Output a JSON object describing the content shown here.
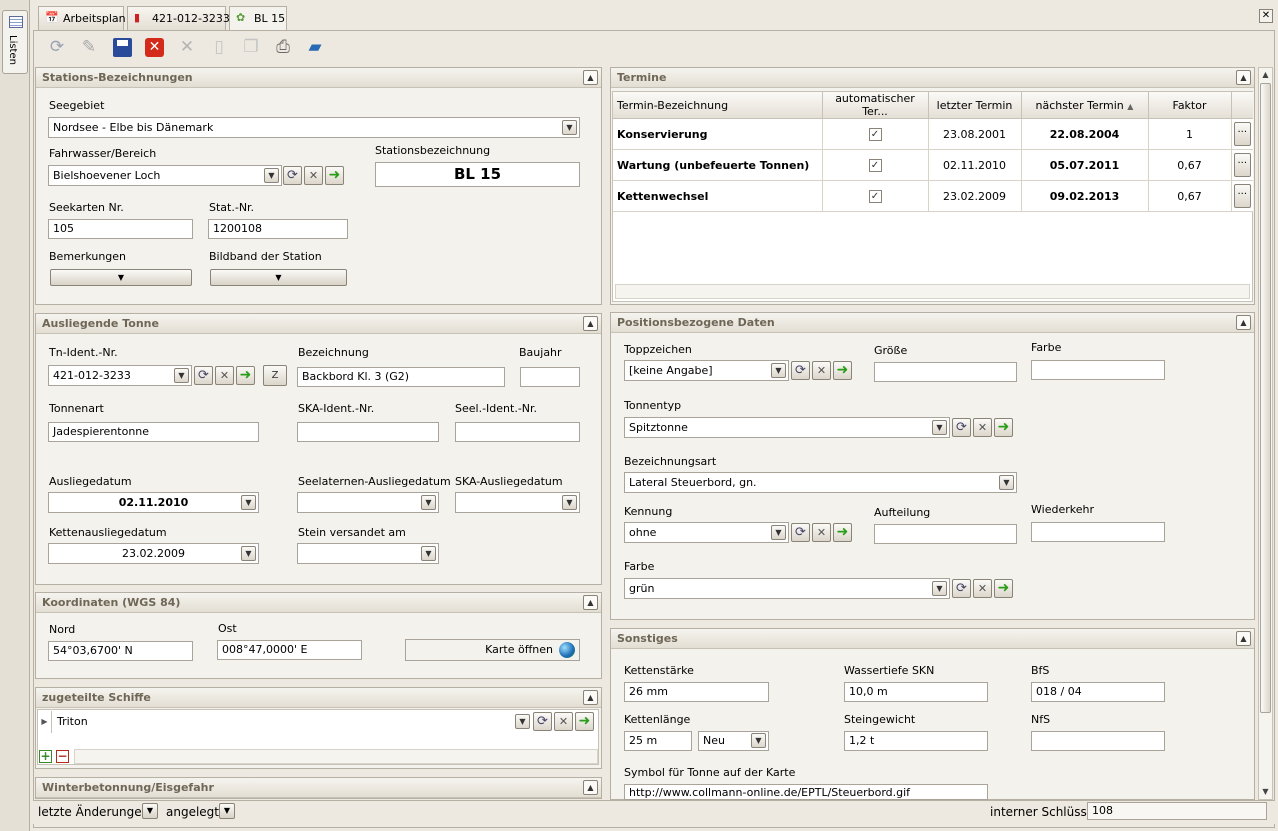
{
  "tabs": [
    {
      "label": "Arbeitsplan"
    },
    {
      "label": "421-012-3233"
    },
    {
      "label": "BL 15"
    }
  ],
  "side_tab": {
    "label": "Listen"
  },
  "stations": {
    "title": "Stations-Bezeichnungen",
    "seegebiet_label": "Seegebiet",
    "seegebiet_value": "Nordsee - Elbe bis Dänemark",
    "fahrwasser_label": "Fahrwasser/Bereich",
    "fahrwasser_value": "Bielshoevener Loch",
    "stationsbez_label": "Stationsbezeichnung",
    "stationsbez_value": "BL 15",
    "seekarten_label": "Seekarten Nr.",
    "seekarten_value": "105",
    "statnr_label": "Stat.-Nr.",
    "statnr_value": "1200108",
    "bemerkungen_label": "Bemerkungen",
    "bildband_label": "Bildband der Station"
  },
  "tonne": {
    "title": "Ausliegende Tonne",
    "tnident_label": "Tn-Ident.-Nr.",
    "tnident_value": "421-012-3233",
    "z_label": "Z",
    "bez_label": "Bezeichnung",
    "bez_value": "Backbord Kl. 3 (G2)",
    "baujahr_label": "Baujahr",
    "baujahr_value": "",
    "tonnenart_label": "Tonnenart",
    "tonnenart_value": "Jadespierentonne",
    "skaident_label": "SKA-Ident.-Nr.",
    "seelident_label": "Seel.-Ident.-Nr.",
    "ausliegedatum_label": "Ausliegedatum",
    "ausliegedatum_value": "02.11.2010",
    "seelaternen_label": "Seelaternen-Ausliegedatum",
    "skaausl_label": "SKA-Ausliegedatum",
    "ketten_label": "Kettenausliegedatum",
    "ketten_value": "23.02.2009",
    "stein_label": "Stein versandet am"
  },
  "koord": {
    "title": "Koordinaten (WGS 84)",
    "nord_label": "Nord",
    "nord_value": "54°03,6700' N",
    "ost_label": "Ost",
    "ost_value": "008°47,0000' E",
    "karte_label": "Karte öffnen"
  },
  "schiffe": {
    "title": "zugeteilte Schiffe",
    "value": "Triton"
  },
  "winter": {
    "title": "Winterbetonnung/Eisgefahr"
  },
  "status": {
    "letzte_label": "letzte Änderungen",
    "angelegt_label": "angelegt",
    "schluessel_label": "interner Schlüssel",
    "schluessel_value": "108"
  },
  "termine": {
    "title": "Termine",
    "headers": [
      "Termin-Bezeichnung",
      "automatischer Ter...",
      "letzter Termin",
      "nächster Termin",
      "Faktor"
    ],
    "rows": [
      {
        "name": "Konservierung",
        "checked": "✓",
        "last": "23.08.2001",
        "next": "22.08.2004",
        "factor": "1"
      },
      {
        "name": "Wartung (unbefeuerte Tonnen)",
        "checked": "✓",
        "last": "02.11.2010",
        "next": "05.07.2011",
        "factor": "0,67"
      },
      {
        "name": "Kettenwechsel",
        "checked": "✓",
        "last": "23.02.2009",
        "next": "09.02.2013",
        "factor": "0,67"
      }
    ]
  },
  "position": {
    "title": "Positionsbezogene Daten",
    "topp_label": "Toppzeichen",
    "topp_value": "[keine Angabe]",
    "groesse_label": "Größe",
    "farbe_label": "Farbe",
    "tonnentyp_label": "Tonnentyp",
    "tonnentyp_value": "Spitztonne",
    "bezart_label": "Bezeichnungsart",
    "bezart_value": "Lateral Steuerbord, gn.",
    "kennung_label": "Kennung",
    "kennung_value": "ohne",
    "aufteilung_label": "Aufteilung",
    "wiederkehr_label": "Wiederkehr",
    "farbe2_label": "Farbe",
    "farbe2_value": "grün"
  },
  "sonstiges": {
    "title": "Sonstiges",
    "kettenstaerke_label": "Kettenstärke",
    "kettenstaerke_value": "26 mm",
    "wassertiefe_label": "Wassertiefe SKN",
    "wassertiefe_value": "10,0 m",
    "bfs_label": "BfS",
    "bfs_value": "018 / 04",
    "kettenlaenge_label": "Kettenlänge",
    "kettenlaenge_value": "25 m",
    "zustand_value": "Neu",
    "steingewicht_label": "Steingewicht",
    "steingewicht_value": "1,2 t",
    "nfs_label": "NfS",
    "symbol_label": "Symbol für Tonne auf der Karte",
    "symbol_value": "http://www.collmann-online.de/EPTL/Steuerbord.gif"
  }
}
